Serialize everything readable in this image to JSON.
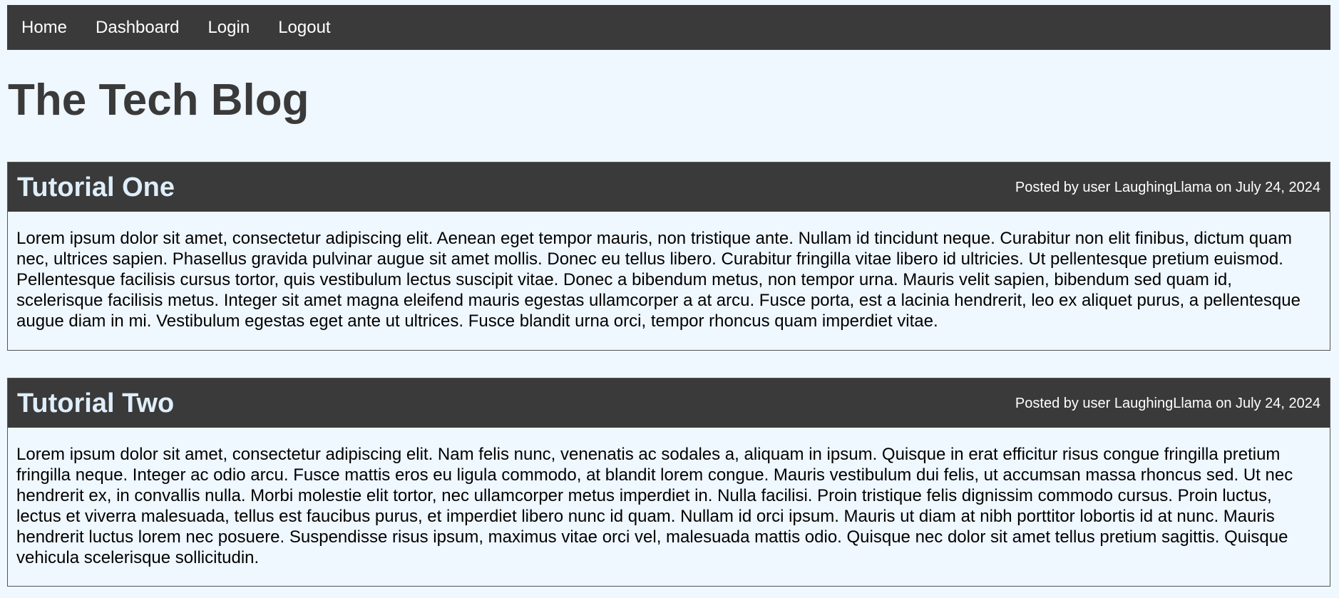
{
  "nav": {
    "items": [
      {
        "label": "Home"
      },
      {
        "label": "Dashboard"
      },
      {
        "label": "Login"
      },
      {
        "label": "Logout"
      }
    ]
  },
  "page": {
    "title": "The Tech Blog"
  },
  "posts": [
    {
      "title": "Tutorial One",
      "meta": "Posted by user LaughingLlama on July 24, 2024",
      "body": "Lorem ipsum dolor sit amet, consectetur adipiscing elit. Aenean eget tempor mauris, non tristique ante. Nullam id tincidunt neque. Curabitur non elit finibus, dictum quam nec, ultrices sapien. Phasellus gravida pulvinar augue sit amet mollis. Donec eu tellus libero. Curabitur fringilla vitae libero id ultricies. Ut pellentesque pretium euismod. Pellentesque facilisis cursus tortor, quis vestibulum lectus suscipit vitae. Donec a bibendum metus, non tempor urna. Mauris velit sapien, bibendum sed quam id, scelerisque facilisis metus. Integer sit amet magna eleifend mauris egestas ullamcorper a at arcu. Fusce porta, est a lacinia hendrerit, leo ex aliquet purus, a pellentesque augue diam in mi. Vestibulum egestas eget ante ut ultrices. Fusce blandit urna orci, tempor rhoncus quam imperdiet vitae."
    },
    {
      "title": "Tutorial Two",
      "meta": "Posted by user LaughingLlama on July 24, 2024",
      "body": "Lorem ipsum dolor sit amet, consectetur adipiscing elit. Nam felis nunc, venenatis ac sodales a, aliquam in ipsum. Quisque in erat efficitur risus congue fringilla pretium fringilla neque. Integer ac odio arcu. Fusce mattis eros eu ligula commodo, at blandit lorem congue. Mauris vestibulum dui felis, ut accumsan massa rhoncus sed. Ut nec hendrerit ex, in convallis nulla. Morbi molestie elit tortor, nec ullamcorper metus imperdiet in. Nulla facilisi. Proin tristique felis dignissim commodo cursus. Proin luctus, lectus et viverra malesuada, tellus est faucibus purus, et imperdiet libero nunc id quam. Nullam id orci ipsum. Mauris ut diam at nibh porttitor lobortis id at nunc. Mauris hendrerit luctus lorem nec posuere. Suspendisse risus ipsum, maximus vitae orci vel, malesuada mattis odio. Quisque nec dolor sit amet tellus pretium sagittis. Quisque vehicula scelerisque sollicitudin."
    }
  ],
  "colors": {
    "page_background": "#eff7ff",
    "nav_background": "#3a3a3a",
    "post_header_background": "#3a3a3a",
    "post_title": "#dfeefb",
    "heading": "#3a3a3a"
  }
}
